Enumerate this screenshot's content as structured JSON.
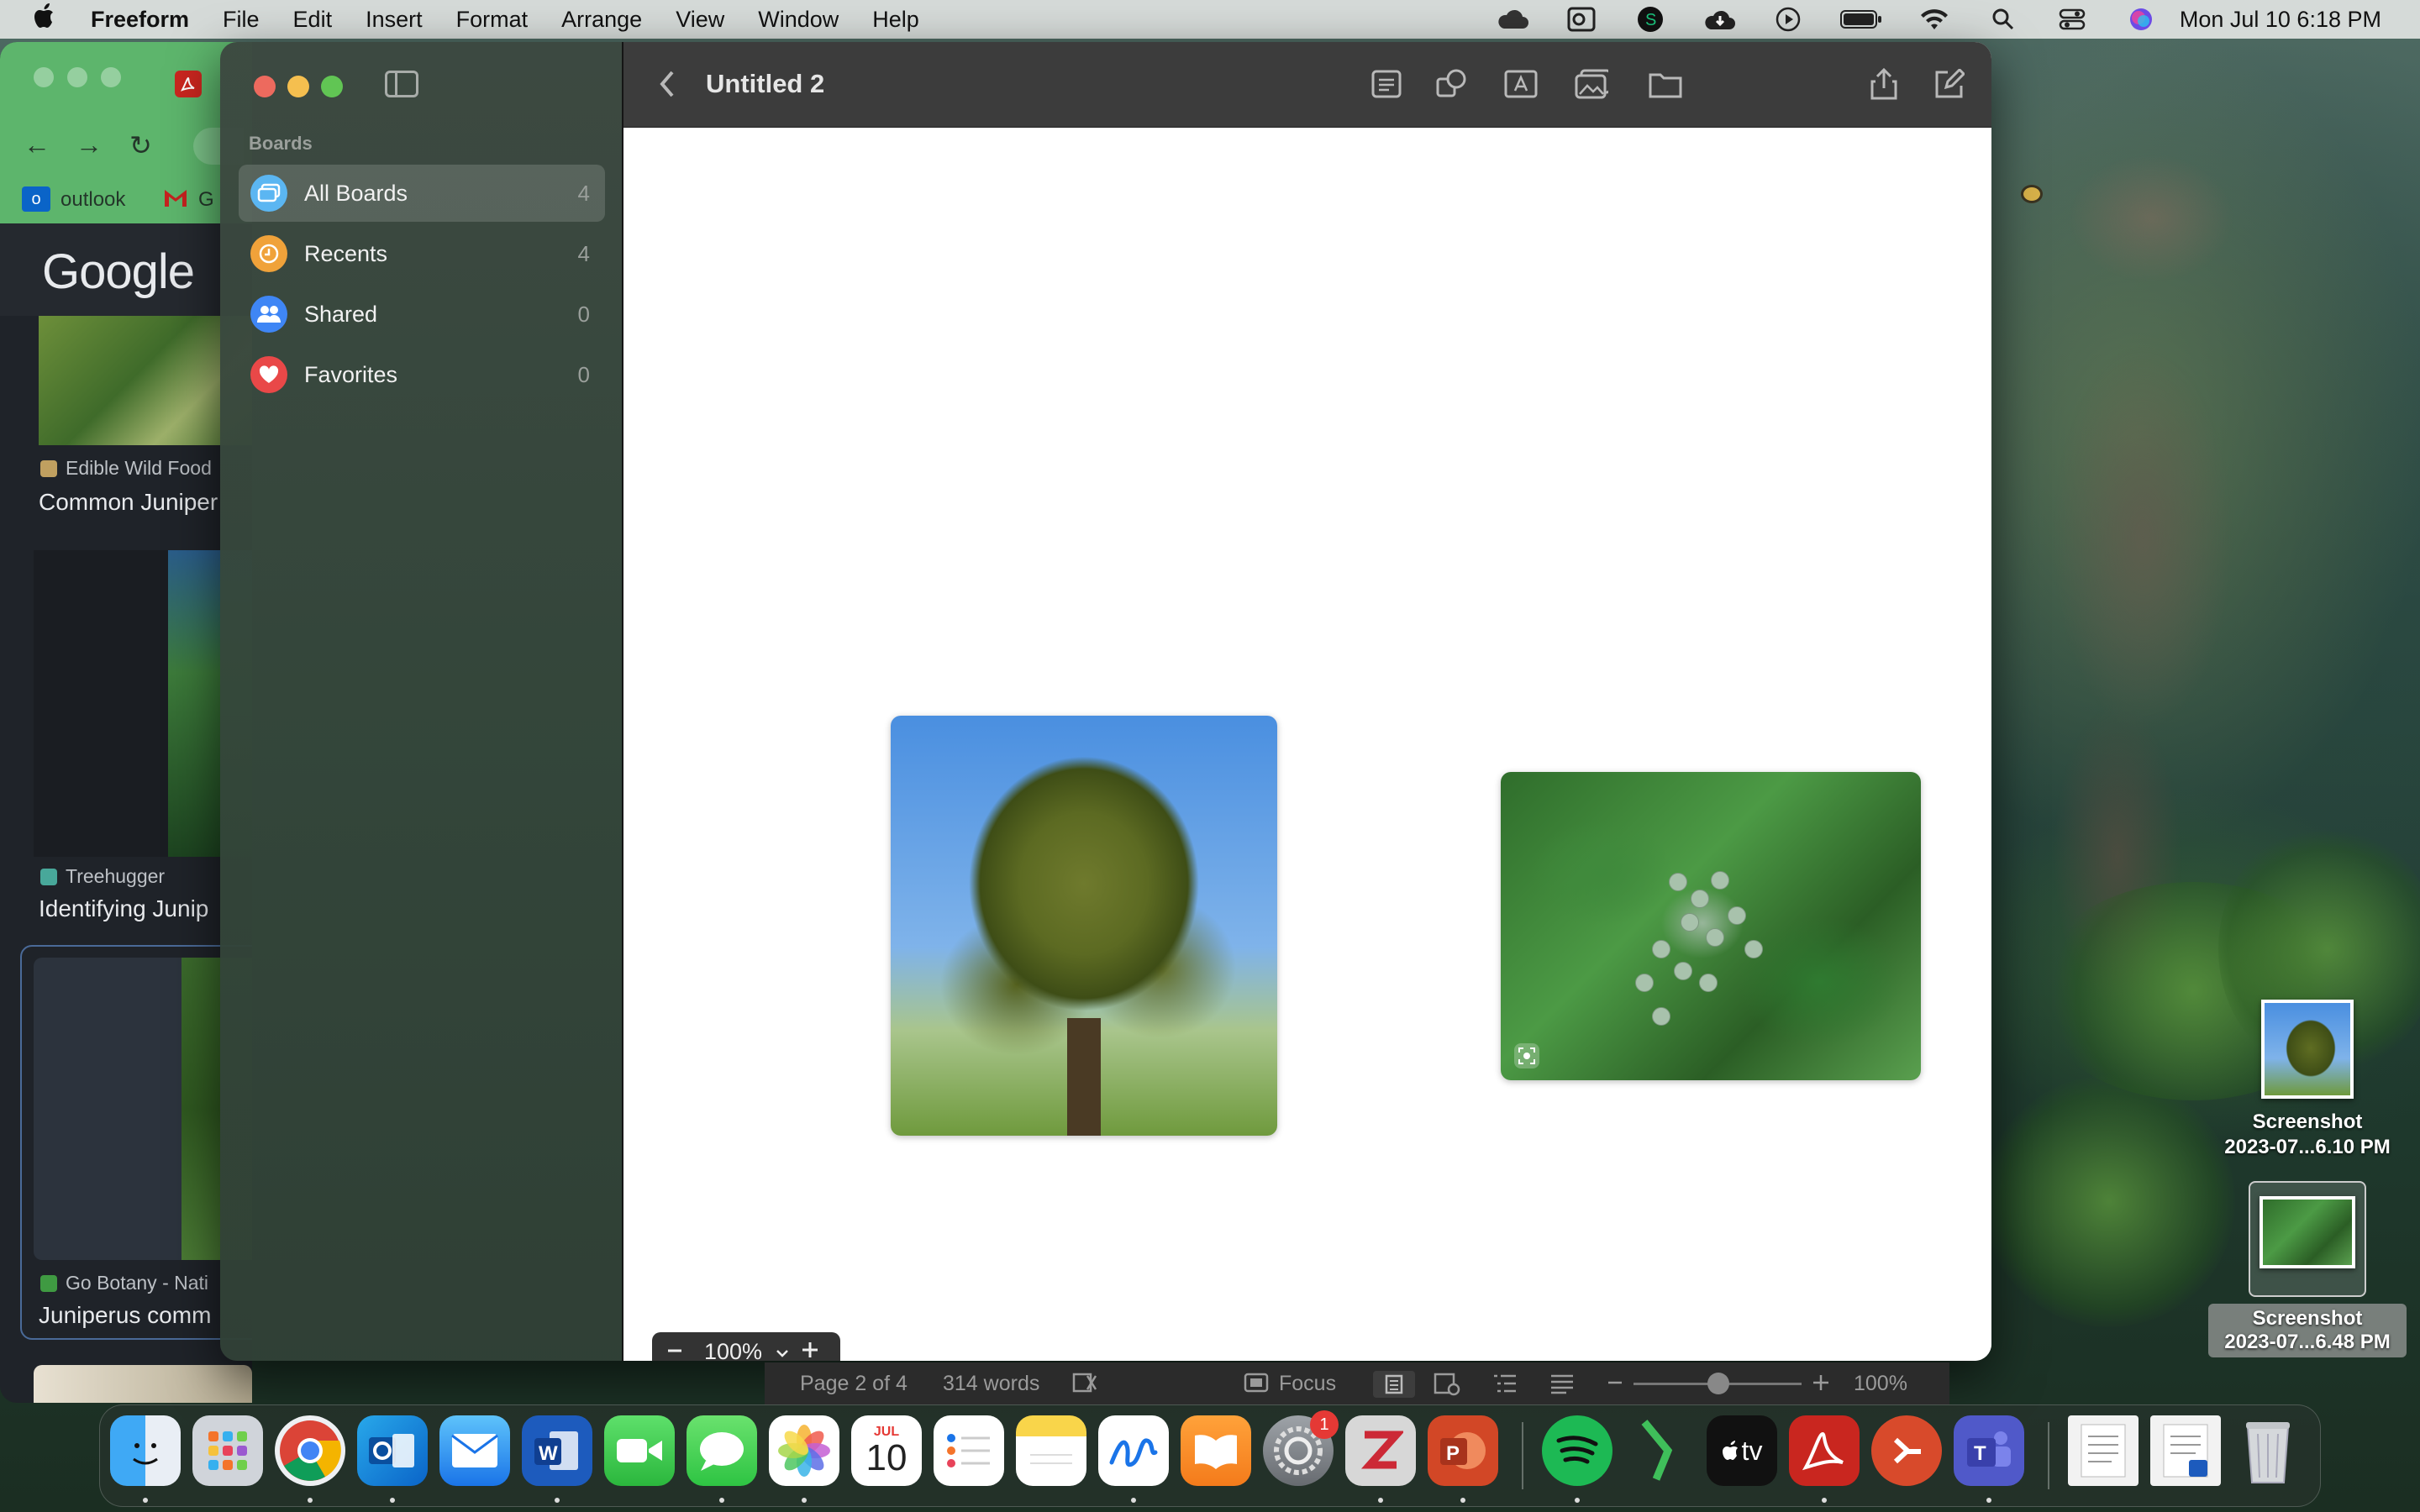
{
  "menubar": {
    "app_name": "Freeform",
    "menus": [
      "File",
      "Edit",
      "Insert",
      "Format",
      "Arrange",
      "View",
      "Window",
      "Help"
    ],
    "clock": "Mon Jul 10  6:18 PM"
  },
  "browser": {
    "bookmark_outlook": "outlook",
    "bookmark_gmail": "G",
    "logo": "Google",
    "results": [
      {
        "source": "Edible Wild Food",
        "title": "Common Juniper"
      },
      {
        "source": "Treehugger",
        "title": "Identifying Junip"
      },
      {
        "source": "Go Botany - Nati",
        "title": "Juniperus comm"
      }
    ]
  },
  "freeform": {
    "sidebar": {
      "heading": "Boards",
      "items": [
        {
          "label": "All Boards",
          "count": "4",
          "color": "#5bb6f2"
        },
        {
          "label": "Recents",
          "count": "4",
          "color": "#f0a23a"
        },
        {
          "label": "Shared",
          "count": "0",
          "color": "#3f86f5"
        },
        {
          "label": "Favorites",
          "count": "0",
          "color": "#e94848"
        }
      ]
    },
    "board_title": "Untitled 2",
    "zoom_value": "100%"
  },
  "word_status": {
    "page": "Page 2 of 4",
    "words": "314 words",
    "focus": "Focus",
    "zoom": "100%"
  },
  "desktop_files": [
    {
      "line1": "Screenshot",
      "line2": "2023-07...6.10 PM"
    },
    {
      "line1": "Screenshot",
      "line2": "2023-07...6.48 PM"
    }
  ],
  "dock": {
    "calendar_month": "JUL",
    "calendar_day": "10",
    "settings_badge": "1",
    "appletv_label": "tv"
  }
}
